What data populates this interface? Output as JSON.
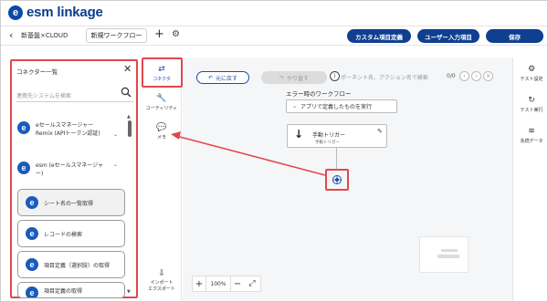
{
  "app": {
    "logo_letter": "e",
    "logo_text": "esm linkage"
  },
  "toolbar": {
    "back_icon": "chevron-left-icon",
    "back_glyph": "‹",
    "project_name": "新基盤×CLOUD",
    "tab_name": "新規ワークフロー",
    "plus": "+",
    "gear": "⚙",
    "custom_fields_label": "カスタム項目定義",
    "user_input_label": "ユーザー入力項目",
    "save_label": "保存",
    "accent": "#0f3f8f"
  },
  "connector_panel": {
    "title": "コネクター一覧",
    "close": "✕",
    "search_placeholder": "連携先システムを検索",
    "connectors": [
      {
        "logo": "e",
        "name": "eセールスマネージャーRemix (APIトークン認証)",
        "expanded": false,
        "chevron": "⌄"
      },
      {
        "logo": "e",
        "name": "esm (eセールスマネージャー)",
        "expanded": true,
        "chevron": "⌃"
      }
    ],
    "operations": [
      {
        "label": "シート名の一覧取得",
        "selected": true
      },
      {
        "label": "レコードの検索",
        "selected": false
      },
      {
        "label": "項目定義（選択肢）の取得",
        "selected": false
      },
      {
        "label": "項目定義の取得",
        "selected": false
      }
    ],
    "scroll_up": "▲",
    "scroll_down": "▼"
  },
  "sidenav": {
    "items": [
      {
        "icon": "connector-icon",
        "glyph": "⇄",
        "label": "コネクタ",
        "active": true
      },
      {
        "icon": "wrench-icon",
        "glyph": "🔧",
        "label": "ユーティリティ",
        "active": false
      },
      {
        "icon": "comment-icon",
        "glyph": "💬",
        "label": "メモ",
        "active": false
      },
      {
        "icon": "import-export-icon",
        "glyph": "⇩",
        "label": "インポート エクスポート",
        "active": false
      }
    ]
  },
  "canvas": {
    "undo_label": "元に戻す",
    "redo_label": "やり直す",
    "info": "i",
    "search_placeholder": "ポーネント名、アクション名で検索",
    "search_count": "0/0",
    "nav_prev": "‹",
    "nav_next": "›",
    "nav_close": "×",
    "error_flow_label": "エラー時のワークフロー",
    "error_flow_select": "アプリで定義したものを実行",
    "trigger_title": "手動トリガー",
    "trigger_sub": "手動トリガー",
    "zoom_level": "100%",
    "zoom_in": "+",
    "zoom_out": "−",
    "fit": "⤢"
  },
  "right_panel": {
    "items": [
      {
        "icon": "settings-icon",
        "glyph": "⚙",
        "label": "テスト設定"
      },
      {
        "icon": "test-run-icon",
        "glyph": "↻",
        "label": "テスト実行"
      },
      {
        "icon": "database-icon",
        "glyph": "≋",
        "label": "永続データ"
      }
    ]
  },
  "annotation_color": "#e0484f"
}
